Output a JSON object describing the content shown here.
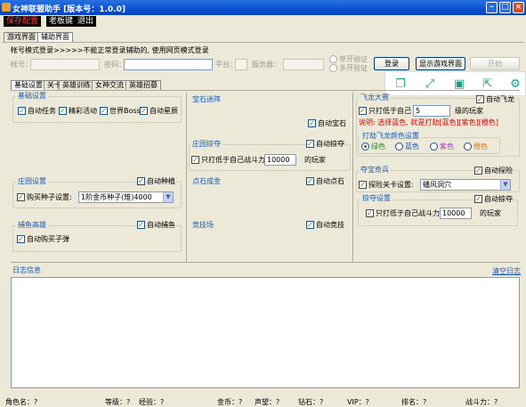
{
  "window": {
    "title": "女神联盟助手 [版本号：1.0.0]"
  },
  "menu": {
    "save": "保存配置",
    "boss_key": "老板键",
    "exit": "退出"
  },
  "main_tabs": {
    "game": "游戏界面",
    "assist": "辅助界面"
  },
  "login": {
    "mode_text": "帐号模式登录>>>>>不能正常登录辅助的, 使用网页模式登录",
    "account_label": "帐号：",
    "password_label": "密码：",
    "platform_label": "平台：",
    "server_label": "服务器：",
    "single_verify": "单开验证",
    "multi_verify": "多开验证",
    "login_button": "登录",
    "show_game_button": "显示游戏界面",
    "start_button": "开始"
  },
  "sub_tabs": [
    "基础设置",
    "关卡",
    "英雄训练",
    "女神交流",
    "英雄招募"
  ],
  "basic": {
    "title": "基础设置",
    "auto_task": "自动任务",
    "event": "精彩活动",
    "world_boss": "世界Boss",
    "auto_star": "自动星辰"
  },
  "gem_maze": {
    "title": "宝石迷阵",
    "auto": "自动宝石"
  },
  "manor_plunder": {
    "title": "庄园掠夺",
    "auto": "自动掠夺",
    "only_lower": "只打低于自己战斗力",
    "power_value": "10000",
    "suffix": "的玩家"
  },
  "manor_setting": {
    "title": "庄园设置",
    "auto": "自动种植",
    "buy_seed": "购买种子设置:",
    "seed_value": "1阶金币种子(雉)4000"
  },
  "stone": {
    "title": "点石成金",
    "auto": "自动点石"
  },
  "fish": {
    "title": "捕鱼高雄",
    "auto": "自动捕鱼",
    "buy_bait": "自动购买子弹"
  },
  "arena": {
    "title": "竞技场",
    "auto": "自动竞技"
  },
  "dragon": {
    "title": "飞龙大赛",
    "auto": "自动飞龙",
    "only_lower": "只打低于自己",
    "level_value": "5",
    "suffix": "级的玩家",
    "note": "说明: 选择蓝色, 就是打劫[蓝色][紫色][橙色]",
    "color_group": "打劫飞龙颜色设置",
    "colors": [
      "绿色",
      "蓝色",
      "紫色",
      "橙色"
    ]
  },
  "treasure": {
    "title": "夺宝奇兵",
    "auto": "自动探险",
    "level_label": "探险关卡设置:",
    "level_value": "蟠风洞穴"
  },
  "plunder": {
    "title": "掠夺设置",
    "auto": "自动掠夺",
    "only_lower": "只打低于自己战斗力",
    "power_value": "10000",
    "suffix": "的玩家"
  },
  "log": {
    "title": "日志信息",
    "clear": "清空日志"
  },
  "status": {
    "role": "角色名：?",
    "level": "等级：?",
    "exp": "经验：?",
    "coin": "金币：?",
    "fame": "声望：?",
    "gem": "钻石：?",
    "vip": "VIP：?",
    "rank": "排名：?",
    "power": "战斗力：?"
  },
  "toolbar_icons": [
    "copy-icon",
    "expand-icon",
    "save-icon",
    "share-icon",
    "gear-icon"
  ],
  "colors": {
    "title_blue": "#0a4fd0",
    "group_blue": "#1a5ab5",
    "red_note": "#e00000",
    "icon_teal": "#1aa080"
  }
}
